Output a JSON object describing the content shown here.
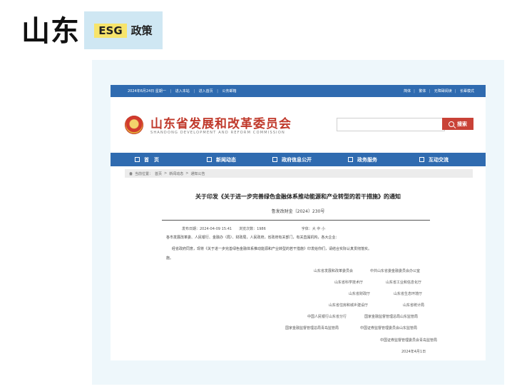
{
  "header": {
    "region": "山东",
    "esg_tag": "ESG",
    "category": "政策"
  },
  "site": {
    "topbar": {
      "date": "2024年6月24日 星期一",
      "links": [
        "进入本站",
        "进入首页",
        "公务邮箱"
      ],
      "right_links": [
        "简体",
        "繁体",
        "无障碍阅读",
        "长辈模式"
      ]
    },
    "name": "山东省发展和改革委员会",
    "name_en": "SHANDONG DEVELOPMENT AND REFORM COMMISSION",
    "search_placeholder": "",
    "search_button": "搜索",
    "nav": [
      "首　页",
      "新闻动态",
      "政府信息公开",
      "政务服务",
      "互动交流"
    ],
    "breadcrumb": [
      "当前位置：",
      "首页",
      "新闻动态",
      "通知公告"
    ]
  },
  "article": {
    "title": "关于印发《关于进一步完善绿色金融体系推动能源和产业转型的若干措施》的通知",
    "doc_number": "鲁发改财金〔2024〕230号",
    "meta": {
      "publish_time": "发布日期：2024-04-09 15:41",
      "views": "浏览次数：1986",
      "font_size": "字体：大 中 小"
    },
    "salutation": "各市发展改革委、人民银行、金融办（局）、财政局，人民政府，省政府有关部门，有关直属机构，各大企业：",
    "body": "经省政府同意，现将《关于进一步完善绿色金融体系推动能源和产业转型的若干措施》印发给你们，请结合实际认真贯彻落实。",
    "body_tail": "施。",
    "signatures": [
      [
        "山东省发展和改革委员会",
        "中共山东省委金融委员会办公室"
      ],
      [
        "山东省科学技术厅",
        "山东省工业和信息化厅"
      ],
      [
        "山东省财政厅",
        "山东省生态环境厅"
      ],
      [
        "山东省住房和城乡建设厅",
        "山东省统计局"
      ],
      [
        "中国人民银行山东省分行",
        "国家金融监督管理总局山东监管局"
      ],
      [
        "国家金融监督管理总局青岛监管局",
        "中国证券监督管理委员会山东监管局"
      ],
      [
        "中国证券监督管理委员会青岛监管局"
      ]
    ],
    "date": "2024年4月1日"
  }
}
